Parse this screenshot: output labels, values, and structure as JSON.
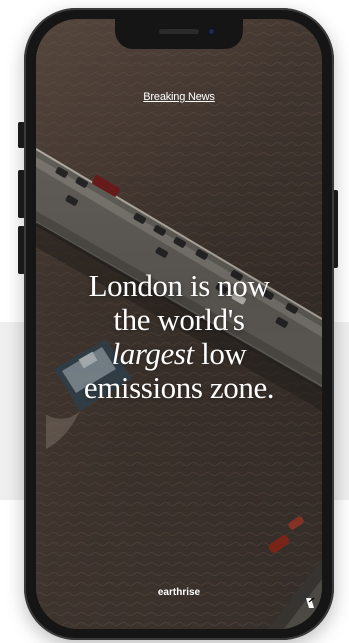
{
  "story": {
    "kicker": "Breaking News",
    "headline": {
      "line1": "London is now",
      "line2": "the world's",
      "line3_emphasis": "largest",
      "line3_rest": " low",
      "line4": "emissions zone."
    },
    "brand": "earthrise"
  },
  "icons": {
    "corner_mark": "app-logo-icon"
  },
  "colors": {
    "text": "#ffffff",
    "phone_frame": "#151515",
    "water": "#4a3d35"
  }
}
